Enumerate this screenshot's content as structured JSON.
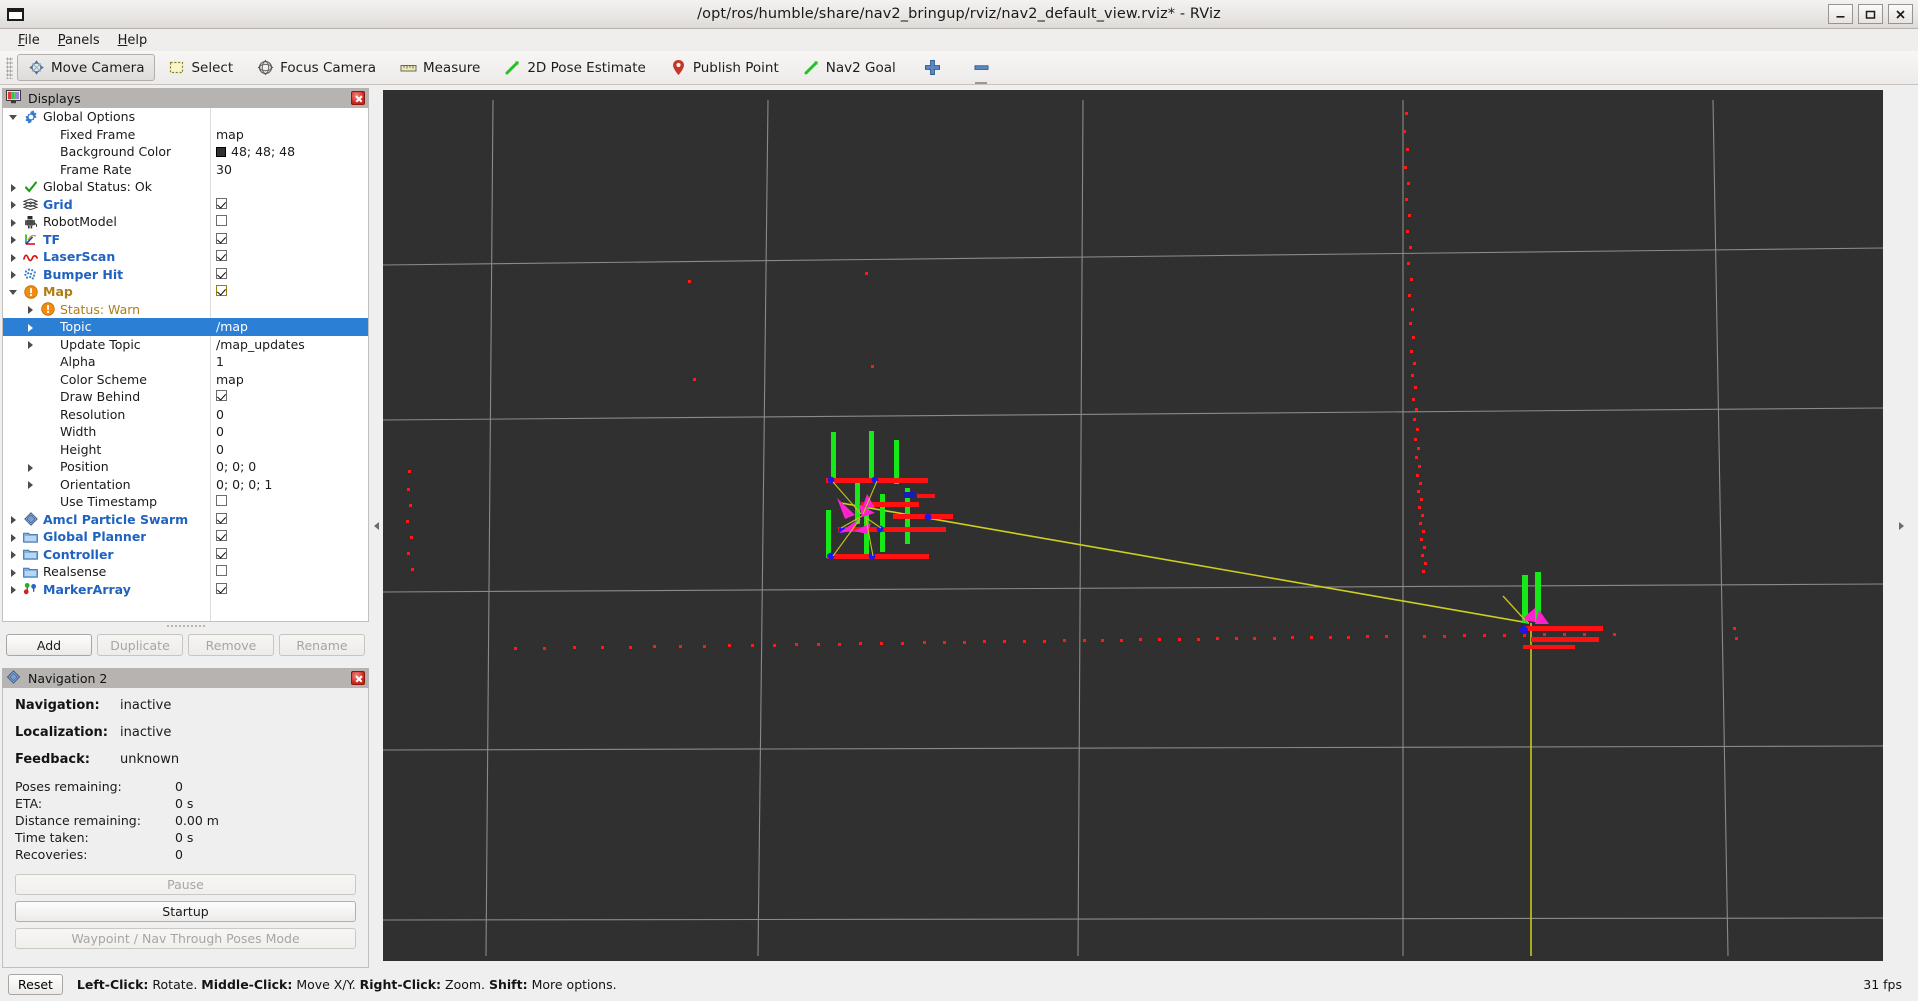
{
  "window": {
    "title": "/opt/ros/humble/share/nav2_bringup/rviz/nav2_default_view.rviz* - RViz",
    "minimize_label": "_",
    "maximize_label": "□",
    "close_label": "✕"
  },
  "menubar": {
    "items": [
      "File",
      "Panels",
      "Help"
    ]
  },
  "toolbar": {
    "tools": [
      {
        "label": "Move Camera",
        "icon": "move-camera-icon",
        "active": true
      },
      {
        "label": "Select",
        "icon": "select-icon",
        "active": false
      },
      {
        "label": "Focus Camera",
        "icon": "focus-camera-icon",
        "active": false
      },
      {
        "label": "Measure",
        "icon": "measure-icon",
        "active": false
      },
      {
        "label": "2D Pose Estimate",
        "icon": "pose-estimate-icon",
        "active": false
      },
      {
        "label": "Publish Point",
        "icon": "publish-point-icon",
        "active": false
      },
      {
        "label": "Nav2 Goal",
        "icon": "nav2-goal-icon",
        "active": false
      },
      {
        "label": "",
        "icon": "plus-icon",
        "active": false
      },
      {
        "label": "",
        "icon": "minus-icon",
        "active": false
      }
    ]
  },
  "displays": {
    "panel_title": "Displays",
    "close_label": "",
    "tree": [
      {
        "indent": 0,
        "arrow": "down",
        "icon": "gear-icon",
        "label": "Global Options",
        "style": "plain",
        "value": "",
        "control": "none"
      },
      {
        "indent": 1,
        "arrow": "none",
        "icon": "none",
        "label": "Fixed Frame",
        "style": "plain",
        "value": "map",
        "control": "none"
      },
      {
        "indent": 1,
        "arrow": "none",
        "icon": "none",
        "label": "Background Color",
        "style": "plain",
        "value": "48; 48; 48",
        "control": "swatch"
      },
      {
        "indent": 1,
        "arrow": "none",
        "icon": "none",
        "label": "Frame Rate",
        "style": "plain",
        "value": "30",
        "control": "none"
      },
      {
        "indent": 0,
        "arrow": "right",
        "icon": "check-ok-icon",
        "label": "Global Status: Ok",
        "style": "plain",
        "value": "",
        "control": "none"
      },
      {
        "indent": 0,
        "arrow": "right",
        "icon": "grid-icon",
        "label": "Grid",
        "style": "blue",
        "value": "",
        "control": "checked"
      },
      {
        "indent": 0,
        "arrow": "right",
        "icon": "robot-model-icon",
        "label": "RobotModel",
        "style": "plain",
        "value": "",
        "control": "unchecked"
      },
      {
        "indent": 0,
        "arrow": "right",
        "icon": "tf-axes-icon",
        "label": "TF",
        "style": "blue",
        "value": "",
        "control": "checked"
      },
      {
        "indent": 0,
        "arrow": "right",
        "icon": "laserscan-icon",
        "label": "LaserScan",
        "style": "blue",
        "value": "",
        "control": "checked"
      },
      {
        "indent": 0,
        "arrow": "right",
        "icon": "bumper-hit-icon",
        "label": "Bumper Hit",
        "style": "blue",
        "value": "",
        "control": "checked"
      },
      {
        "indent": 0,
        "arrow": "down",
        "icon": "warn-icon",
        "label": "Map",
        "style": "amber",
        "value": "",
        "control": "checked-amber"
      },
      {
        "indent": 1,
        "arrow": "right",
        "icon": "warn-icon",
        "label": "Status: Warn",
        "style": "amber-n",
        "value": "",
        "control": "none"
      },
      {
        "indent": 1,
        "arrow": "right",
        "icon": "none",
        "label": "Topic",
        "style": "plain",
        "value": "/map",
        "control": "none",
        "selected": true
      },
      {
        "indent": 1,
        "arrow": "right",
        "icon": "none",
        "label": "Update Topic",
        "style": "plain",
        "value": "/map_updates",
        "control": "none"
      },
      {
        "indent": 1,
        "arrow": "none",
        "icon": "none",
        "label": "Alpha",
        "style": "plain",
        "value": "1",
        "control": "none"
      },
      {
        "indent": 1,
        "arrow": "none",
        "icon": "none",
        "label": "Color Scheme",
        "style": "plain",
        "value": "map",
        "control": "none"
      },
      {
        "indent": 1,
        "arrow": "none",
        "icon": "none",
        "label": "Draw Behind",
        "style": "plain",
        "value": "",
        "control": "checked"
      },
      {
        "indent": 1,
        "arrow": "none",
        "icon": "none",
        "label": "Resolution",
        "style": "plain",
        "value": "0",
        "control": "none"
      },
      {
        "indent": 1,
        "arrow": "none",
        "icon": "none",
        "label": "Width",
        "style": "plain",
        "value": "0",
        "control": "none"
      },
      {
        "indent": 1,
        "arrow": "none",
        "icon": "none",
        "label": "Height",
        "style": "plain",
        "value": "0",
        "control": "none"
      },
      {
        "indent": 1,
        "arrow": "right",
        "icon": "none",
        "label": "Position",
        "style": "plain",
        "value": "0; 0; 0",
        "control": "none"
      },
      {
        "indent": 1,
        "arrow": "right",
        "icon": "none",
        "label": "Orientation",
        "style": "plain",
        "value": "0; 0; 0; 1",
        "control": "none"
      },
      {
        "indent": 1,
        "arrow": "none",
        "icon": "none",
        "label": "Use Timestamp",
        "style": "plain",
        "value": "",
        "control": "unchecked"
      },
      {
        "indent": 0,
        "arrow": "right",
        "icon": "particle-icon",
        "label": "Amcl Particle Swarm",
        "style": "blue",
        "value": "",
        "control": "checked"
      },
      {
        "indent": 0,
        "arrow": "right",
        "icon": "folder-icon",
        "label": "Global Planner",
        "style": "blue",
        "value": "",
        "control": "checked"
      },
      {
        "indent": 0,
        "arrow": "right",
        "icon": "folder-icon",
        "label": "Controller",
        "style": "blue",
        "value": "",
        "control": "checked"
      },
      {
        "indent": 0,
        "arrow": "right",
        "icon": "folder-icon",
        "label": "Realsense",
        "style": "plain",
        "value": "",
        "control": "unchecked"
      },
      {
        "indent": 0,
        "arrow": "right",
        "icon": "markerarray-icon",
        "label": "MarkerArray",
        "style": "blue",
        "value": "",
        "control": "checked"
      }
    ],
    "buttons": [
      {
        "label": "Add",
        "enabled": true
      },
      {
        "label": "Duplicate",
        "enabled": false
      },
      {
        "label": "Remove",
        "enabled": false
      },
      {
        "label": "Rename",
        "enabled": false
      }
    ]
  },
  "navigation2": {
    "panel_title": "Navigation 2",
    "fields": [
      {
        "key": "Navigation:",
        "value": "inactive"
      },
      {
        "key": "Localization:",
        "value": "inactive"
      },
      {
        "key": "Feedback:",
        "value": "unknown"
      }
    ],
    "stats": [
      {
        "key": "Poses remaining:",
        "value": "0"
      },
      {
        "key": "ETA:",
        "value": "0 s"
      },
      {
        "key": "Distance remaining:",
        "value": "0.00 m"
      },
      {
        "key": "Time taken:",
        "value": "0 s"
      },
      {
        "key": "Recoveries:",
        "value": "0"
      }
    ],
    "buttons": [
      {
        "label": "Pause",
        "enabled": false
      },
      {
        "label": "Startup",
        "enabled": true
      },
      {
        "label": "Waypoint / Nav Through Poses Mode",
        "enabled": false
      }
    ]
  },
  "statusbar": {
    "reset_label": "Reset",
    "hint_parts": [
      {
        "text": "Left-Click:",
        "bold": true
      },
      {
        "text": " Rotate. ",
        "bold": false
      },
      {
        "text": "Middle-Click:",
        "bold": true
      },
      {
        "text": " Move X/Y. ",
        "bold": false
      },
      {
        "text": "Right-Click:",
        "bold": true
      },
      {
        "text": " Zoom. ",
        "bold": false
      },
      {
        "text": "Shift:",
        "bold": true
      },
      {
        "text": " More options.",
        "bold": false
      }
    ],
    "fps": "31 fps"
  },
  "viewport": {
    "background_color": "#303030",
    "grid_color": "#9a9a9a",
    "laser_color": "#ff0000",
    "path_color": "#c8c800",
    "axis_colors": {
      "x": "#ff0000",
      "y": "#00ff00",
      "z": "#0000ff"
    }
  }
}
